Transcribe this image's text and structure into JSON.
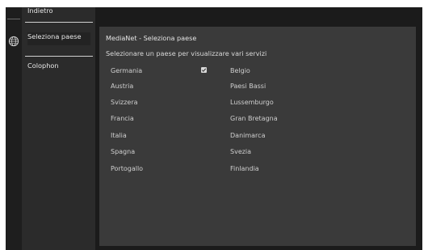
{
  "menu": {
    "items": [
      {
        "label": "Indietro"
      },
      {
        "label": "Seleziona paese"
      },
      {
        "label": "Colophon"
      }
    ]
  },
  "icons": {
    "globe": "globe-icon",
    "check": "checkbox-checked-icon"
  },
  "panel": {
    "title": "MediaNet - Seleziona paese",
    "description": "Selezionare un paese per visualizzare vari servizi",
    "selected_country": "Germania",
    "countries_left": [
      "Germania",
      "Austria",
      "Svizzera",
      "Francia",
      "Italia",
      "Spagna",
      "Portogallo"
    ],
    "countries_right": [
      "Belgio",
      "Paesi Bassi",
      "Lussemburgo",
      "Gran Bretagna",
      "Danimarca",
      "Svezia",
      "Finlandia"
    ]
  },
  "colors": {
    "background": "#1b1b1b",
    "menu_background": "#2b2b2b",
    "panel_background": "#3a3a3a",
    "text": "#d8d8d8"
  }
}
